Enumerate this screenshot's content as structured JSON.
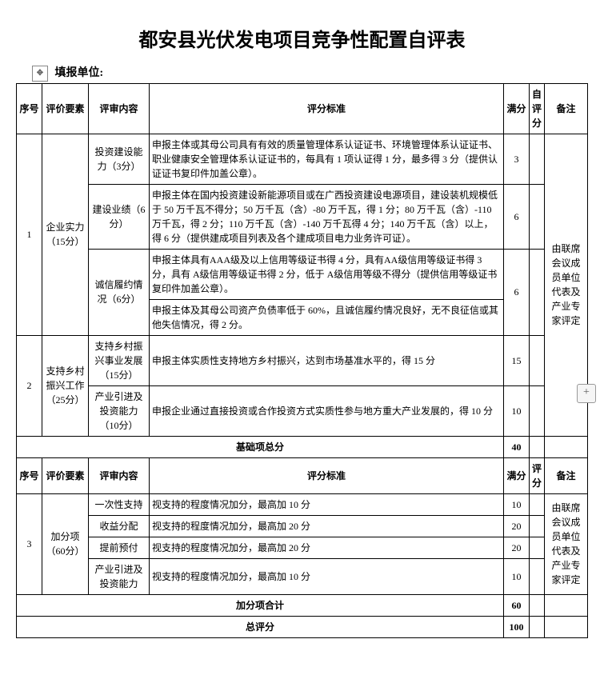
{
  "title": "都安县光伏发电项目竞争性配置自评表",
  "reporting_unit_label": "填报单位:",
  "headers": {
    "seq": "序号",
    "factor": "评价要素",
    "content": "评审内容",
    "criteria": "评分标准",
    "maxscore": "满分",
    "selfscore": "自评分",
    "selfscore2": "评分",
    "note": "备注"
  },
  "section1": {
    "seq": "1",
    "factor": "企业实力（15分）",
    "rows": [
      {
        "content": "投资建设能力（3分）",
        "criteria": "申报主体或其母公司具有有效的质量管理体系认证证书、环境管理体系认证证书、职业健康安全管理体系认证证书的，每具有 1 项认证得 1 分，最多得 3 分（提供认证证书复印件加盖公章）。",
        "max": "3"
      },
      {
        "content": "建设业绩（6分）",
        "criteria": "申报主体在国内投资建设新能源项目或在广西投资建设电源项目，建设装机规模低于 50 万千瓦不得分；50 万千瓦（含）-80 万千瓦，得 1 分；80 万千瓦（含）-110 万千瓦，得 2 分；110 万千瓦（含）-140 万千瓦得 4 分；140 万千瓦（含）以上，得 6 分（提供建成项目列表及各个建成项目电力业务许可证）。",
        "max": "6"
      },
      {
        "content": "诚信履约情况（6分）",
        "criteria_a": "申报主体具有AAA级及以上信用等级证书得 4 分，具有AA级信用等级证书得 3 分，具有 A级信用等级证书得 2 分，低于 A级信用等级不得分（提供信用等级证书复印件加盖公章）。",
        "criteria_b": "申报主体及其母公司资产负债率低于 60%，且诚信履约情况良好，无不良征信或其他失信情况，得 2 分。",
        "max": "6"
      }
    ],
    "note": "由联席会议成员单位代表及产业专家评定"
  },
  "section2": {
    "seq": "2",
    "factor": "支持乡村振兴工作（25分）",
    "rows": [
      {
        "content": "支持乡村振兴事业发展（15分）",
        "criteria": "申报主体实质性支持地方乡村振兴，达到市场基准水平的，得 15 分",
        "max": "15"
      },
      {
        "content": "产业引进及投资能力（10分）",
        "criteria": "申报企业通过直接投资或合作投资方式实质性参与地方重大产业发展的，得 10 分",
        "max": "10"
      }
    ]
  },
  "subtotal1": {
    "label": "基础项总分",
    "value": "40"
  },
  "section3": {
    "seq": "3",
    "factor": "加分项（60分）",
    "rows": [
      {
        "content": "一次性支持",
        "criteria": "视支持的程度情况加分，最高加 10 分",
        "max": "10"
      },
      {
        "content": "收益分配",
        "criteria": "视支持的程度情况加分，最高加 20 分",
        "max": "20"
      },
      {
        "content": "提前预付",
        "criteria": "视支持的程度情况加分，最高加 20 分",
        "max": "20"
      },
      {
        "content": "产业引进及投资能力",
        "criteria": "视支持的程度情况加分，最高加 10 分",
        "max": "10"
      }
    ],
    "note": "由联席会议成员单位代表及产业专家评定"
  },
  "subtotal2": {
    "label": "加分项合计",
    "value": "60"
  },
  "total": {
    "label": "总评分",
    "value": "100"
  }
}
